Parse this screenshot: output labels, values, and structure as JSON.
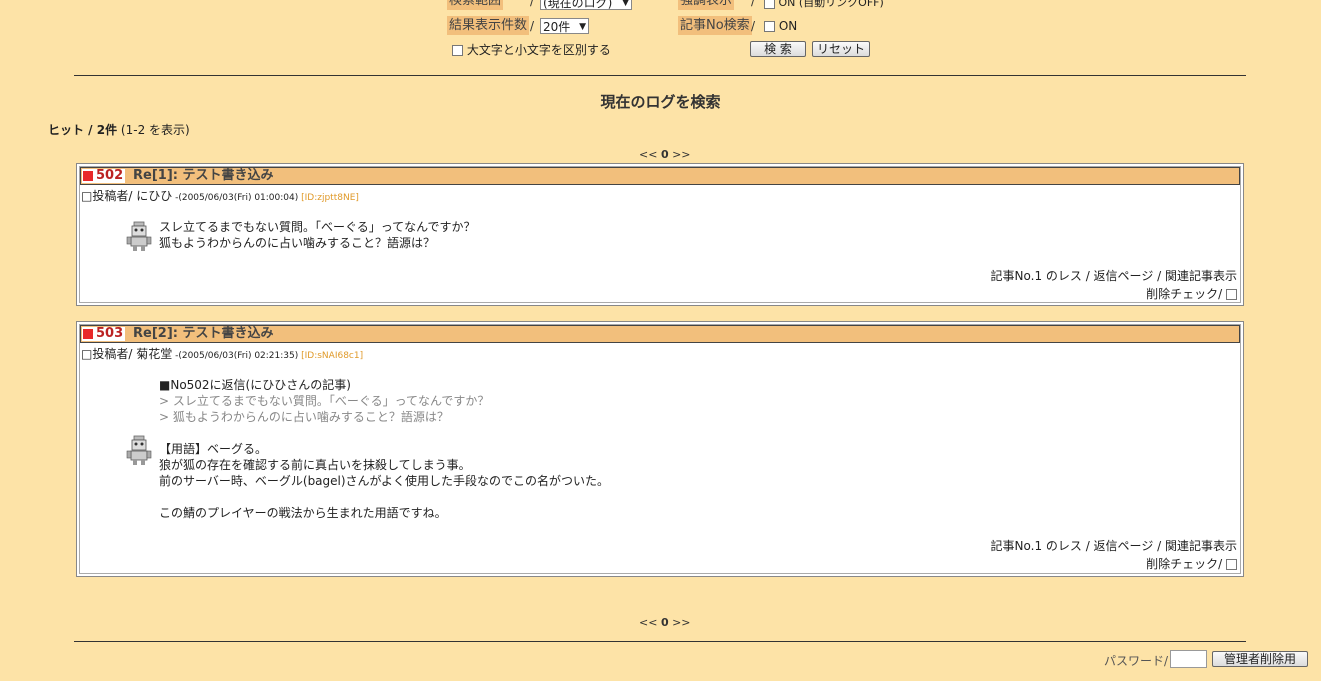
{
  "search": {
    "range_label": "検索範囲",
    "range_value": "(現在のログ)",
    "count_label": "結果表示件数",
    "count_value": "20件",
    "case_label": "大文字と小文字を区別する",
    "highlight_label": "強調表示",
    "highlight_option": "ON (自動リンクOFF)",
    "no_search_label": "記事No検索",
    "no_search_option": "ON",
    "slash": "/",
    "search_button": "検 索",
    "reset_button": "リセット"
  },
  "results": {
    "heading": "現在のログを検索",
    "hit_label": "ヒット / 2件",
    "hit_range": "(1-2 を表示)"
  },
  "pager": {
    "prev": "<<",
    "page": "0",
    "next": ">>"
  },
  "posts": [
    {
      "number": "502",
      "title": "Re[1]: テスト書き込み",
      "author_prefix": "□投稿者/ ",
      "author": "にひひ",
      "date": " -(2005/06/03(Fri) 01:00:04)",
      "id": " [ID:zjptt8NE]",
      "quote_header": "",
      "quotes": [],
      "lines": [
        "スレ立てるまでもない質問。「べーぐる」ってなんですか？",
        "狐もようわからんのに占い噛みすること？語源は？"
      ],
      "footer": "記事No.1 のレス / 返信ページ / 関連記事表示",
      "delete_check": "削除チェック/"
    },
    {
      "number": "503",
      "title": "Re[2]: テスト書き込み",
      "author_prefix": "□投稿者/ ",
      "author": "菊花堂",
      "date": " -(2005/06/03(Fri) 02:21:35)",
      "id": " [ID:sNAI68c1]",
      "quote_header": "■No502に返信(にひひさんの記事)",
      "quotes": [
        "> スレ立てるまでもない質問。「べーぐる」ってなんですか？",
        "> 狐もようわからんのに占い噛みすること？語源は？"
      ],
      "lines": [
        "【用語】ベーグる。",
        "狼が狐の存在を確認する前に真占いを抹殺してしまう事。",
        "前のサーバー時、ベーグル(bagel)さんがよく使用した手段なのでこの名がついた。",
        "",
        "この鯖のプレイヤーの戦法から生まれた用語ですね。"
      ],
      "footer": "記事No.1 のレス / 返信ページ / 関連記事表示",
      "delete_check": "削除チェック/"
    }
  ],
  "admin": {
    "password_label": "パスワード/",
    "delete_button": "管理者削除用"
  }
}
